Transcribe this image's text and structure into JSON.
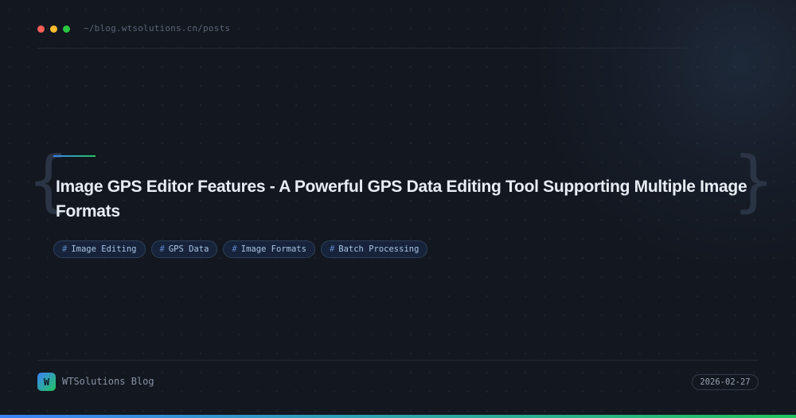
{
  "window": {
    "controls": [
      {
        "name": "close",
        "color": "#ff5f57"
      },
      {
        "name": "minimize",
        "color": "#febc2e"
      },
      {
        "name": "maximize",
        "color": "#28c840"
      }
    ],
    "path": "~/blog.wtsolutions.cn/posts"
  },
  "post": {
    "brace_open": "{",
    "brace_close": "}",
    "title": "Image GPS Editor Features - A Powerful GPS Data Editing Tool Supporting Multiple Image Formats",
    "tag_prefix": "#",
    "tags": [
      {
        "label": "Image Editing"
      },
      {
        "label": "GPS Data"
      },
      {
        "label": "Image Formats"
      },
      {
        "label": "Batch Processing"
      }
    ]
  },
  "footer": {
    "logo_letter": "W",
    "site_name": "WTSolutions Blog",
    "date": "2026-02-27"
  },
  "colors": {
    "background": "#131720",
    "accent_blue": "#3b82f6",
    "accent_green": "#22c55e",
    "tag_text": "#a9c4e6"
  }
}
